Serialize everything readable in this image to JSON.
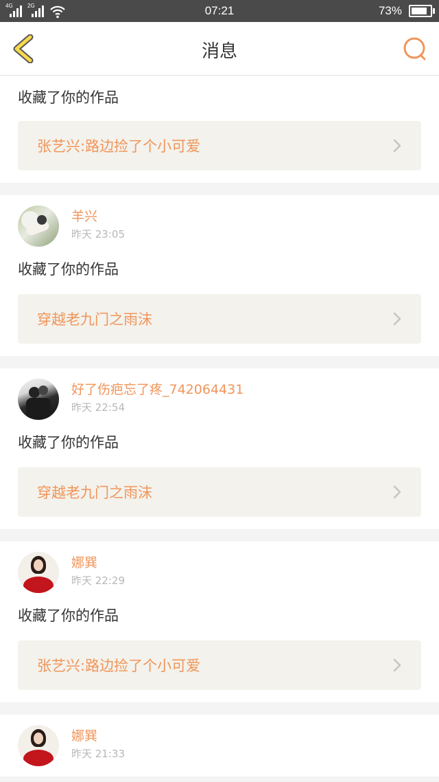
{
  "status_bar": {
    "network_1": "4G",
    "network_2": "2G",
    "time": "07:21",
    "battery_percent": "73%",
    "battery_level": 0.73
  },
  "header": {
    "title": "消息",
    "back_icon": "chevron-left-icon",
    "search_icon": "search-icon"
  },
  "colors": {
    "accent": "#f0955a",
    "back_icon_fill": "#f7d94c",
    "work_link_bg": "#f3f2ec",
    "status_bar_bg": "#4a4a4a"
  },
  "messages": [
    {
      "action": "收藏了你的作品",
      "work_title": "张艺兴:路边捡了个小可爱"
    },
    {
      "user_name": "羊兴",
      "time": "昨天 23:05",
      "action": "收藏了你的作品",
      "work_title": "穿越老九门之雨沫"
    },
    {
      "user_name": "好了伤疤忘了疼_742064431",
      "time": "昨天 22:54",
      "action": "收藏了你的作品",
      "work_title": "穿越老九门之雨沫"
    },
    {
      "user_name": "娜巽",
      "time": "昨天 22:29",
      "action": "收藏了你的作品",
      "work_title": "张艺兴:路边捡了个小可爱"
    },
    {
      "user_name": "娜巽",
      "time": "昨天 21:33"
    }
  ]
}
